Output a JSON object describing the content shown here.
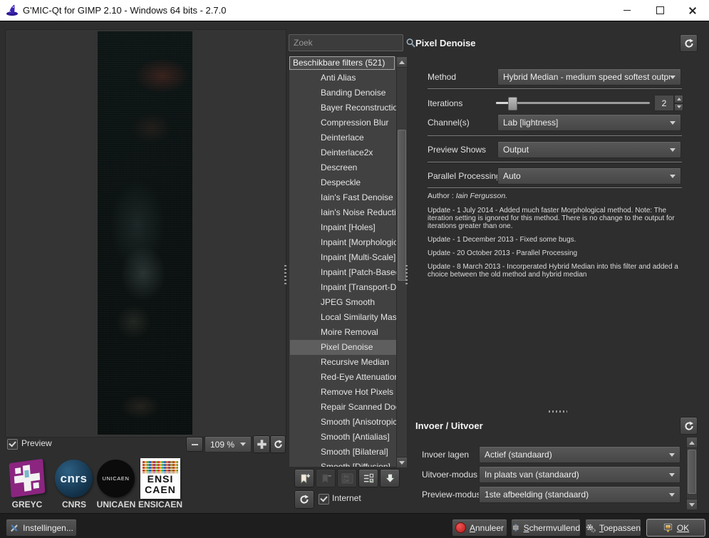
{
  "window": {
    "title": "G'MIC-Qt for GIMP 2.10 - Windows 64 bits - 2.7.0"
  },
  "left": {
    "preview_label": "Preview",
    "zoom_value": "109 %",
    "cnrs_text": "cnrs",
    "unicaen_text": "UNICAEN",
    "ensicaen_line1": "ENSI",
    "ensicaen_line2": "CAEN",
    "logos": [
      {
        "label": "GREYC"
      },
      {
        "label": "CNRS"
      },
      {
        "label": "UNICAEN"
      },
      {
        "label": "ENSICAEN"
      }
    ],
    "settings_label": "Instellingen..."
  },
  "filters": {
    "search_placeholder": "Zoek",
    "header": "Beschikbare filters (521)",
    "items": [
      "Anti Alias",
      "Banding Denoise",
      "Bayer Reconstruction",
      "Compression Blur",
      "Deinterlace",
      "Deinterlace2x",
      "Descreen",
      "Despeckle",
      "Iain's Fast Denoise",
      "Iain's Noise Reduction",
      "Inpaint [Holes]",
      "Inpaint [Morphologica",
      "Inpaint [Multi-Scale]",
      "Inpaint [Patch-Based]",
      "Inpaint [Transport-Di",
      "JPEG Smooth",
      "Local Similarity Mask",
      "Moire Removal",
      "Pixel Denoise",
      "Recursive Median",
      "Red-Eye Attenuation",
      "Remove Hot Pixels",
      "Repair Scanned Docu",
      "Smooth [Anisotropic]",
      "Smooth [Antialias]",
      "Smooth [Bilateral]",
      "Smooth [Diffusion]"
    ],
    "selected_item": "Pixel Denoise",
    "internet_label": "Internet"
  },
  "panel": {
    "title": "Pixel Denoise",
    "method_label": "Method",
    "method_value": "Hybrid Median - medium speed softest output",
    "iterations_label": "Iterations",
    "iterations_value": "2",
    "channels_label": "Channel(s)",
    "channels_value": "Lab [lightness]",
    "preview_shows_label": "Preview Shows",
    "preview_shows_value": "Output",
    "parallel_label": "Parallel Processing",
    "parallel_value": "Auto",
    "author_prefix": "Author : ",
    "author_name": "Iain Fergusson.",
    "updates": [
      "Update - 1 July 2014 - Added much faster Morphological method. Note: The iteration setting is ignored for this method. There is no change to the output for iterations greater than one.",
      "Update - 1 December 2013 - Fixed some bugs.",
      "Update - 20 October 2013 - Parallel Processing",
      "Update - 8 March 2013 - Incorperated Hybrid Median into this filter and added a choice between the old method and hybrid median"
    ]
  },
  "io": {
    "title": "Invoer / Uitvoer",
    "rows": [
      {
        "label": "Invoer lagen",
        "value": "Actief (standaard)"
      },
      {
        "label": "Uitvoer-modus",
        "value": "In plaats van (standaard)"
      },
      {
        "label": "Preview-modus",
        "value": "1ste afbeelding (standaard)"
      }
    ]
  },
  "actions": {
    "cancel_key": "A",
    "cancel_rest": "nnuleer",
    "fullscreen_key": "S",
    "fullscreen_rest": "chermvullend",
    "apply_key": "T",
    "apply_rest": "oepassen",
    "ok": "OK"
  },
  "colors": {
    "selection": "#5e5e5e",
    "cancel_icon": "#d62f2f",
    "greyc_purple": "#8b2580",
    "accent_blue": "#4a7fb5"
  }
}
